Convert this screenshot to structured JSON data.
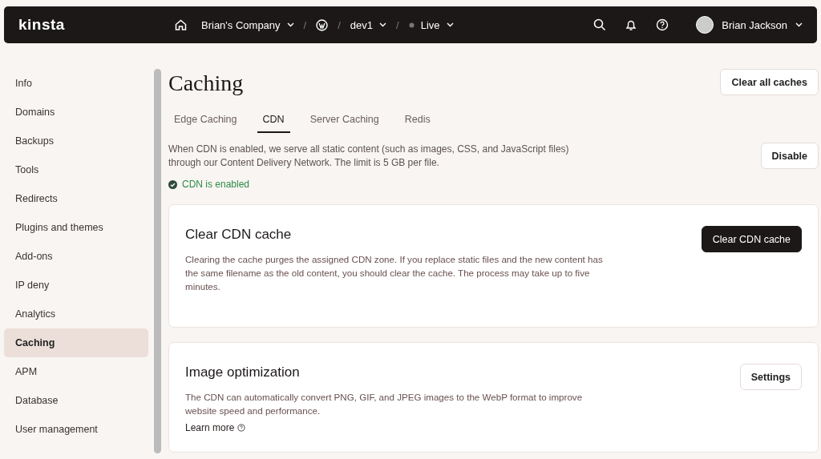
{
  "topbar": {
    "logo": "kinsta",
    "breadcrumbs": [
      {
        "kind": "home",
        "label": "Brian's Company",
        "dropdown": true
      },
      {
        "kind": "separator",
        "label": "/"
      },
      {
        "kind": "wordpress"
      },
      {
        "kind": "separator",
        "label": "/"
      },
      {
        "kind": "site",
        "label": "dev1",
        "dropdown": true
      },
      {
        "kind": "separator",
        "label": "/"
      },
      {
        "kind": "status",
        "label": "Live",
        "dropdown": true
      }
    ],
    "user": {
      "name": "Brian Jackson"
    }
  },
  "sidebar": {
    "items": [
      {
        "label": "Info",
        "selected": false
      },
      {
        "label": "Domains",
        "selected": false
      },
      {
        "label": "Backups",
        "selected": false
      },
      {
        "label": "Tools",
        "selected": false
      },
      {
        "label": "Redirects",
        "selected": false
      },
      {
        "label": "Plugins and themes",
        "selected": false
      },
      {
        "label": "Add-ons",
        "selected": false
      },
      {
        "label": "IP deny",
        "selected": false
      },
      {
        "label": "Analytics",
        "selected": false
      },
      {
        "label": "Caching",
        "selected": true
      },
      {
        "label": "APM",
        "selected": false
      },
      {
        "label": "Database",
        "selected": false
      },
      {
        "label": "User management",
        "selected": false
      }
    ]
  },
  "page": {
    "title": "Caching",
    "action": "Clear all caches",
    "tabs": [
      {
        "label": "Edge Caching",
        "selected": false
      },
      {
        "label": "CDN",
        "selected": true
      },
      {
        "label": "Server Caching",
        "selected": false
      },
      {
        "label": "Redis",
        "selected": false
      }
    ],
    "description": "When CDN is enabled, we serve all static content (such as images, CSS, and JavaScript files) through our Content Delivery Network. The limit is 5 GB per file.",
    "toggle_button": "Disable",
    "status": {
      "label": "CDN is enabled",
      "enabled": true
    },
    "cards": [
      {
        "title": "Clear CDN cache",
        "text": "Clearing the cache purges the assigned CDN zone. If you replace static files and the new content has the same filename as the old content, you should clear the cache. The process may take up to five minutes.",
        "button": "Clear CDN cache",
        "primary": true
      },
      {
        "title": "Image optimization",
        "text": "The CDN can automatically convert PNG, GIF, and JPEG images to the WebP format to improve website speed and performance.",
        "button": "Settings",
        "primary": false,
        "link": "Learn more"
      }
    ]
  }
}
